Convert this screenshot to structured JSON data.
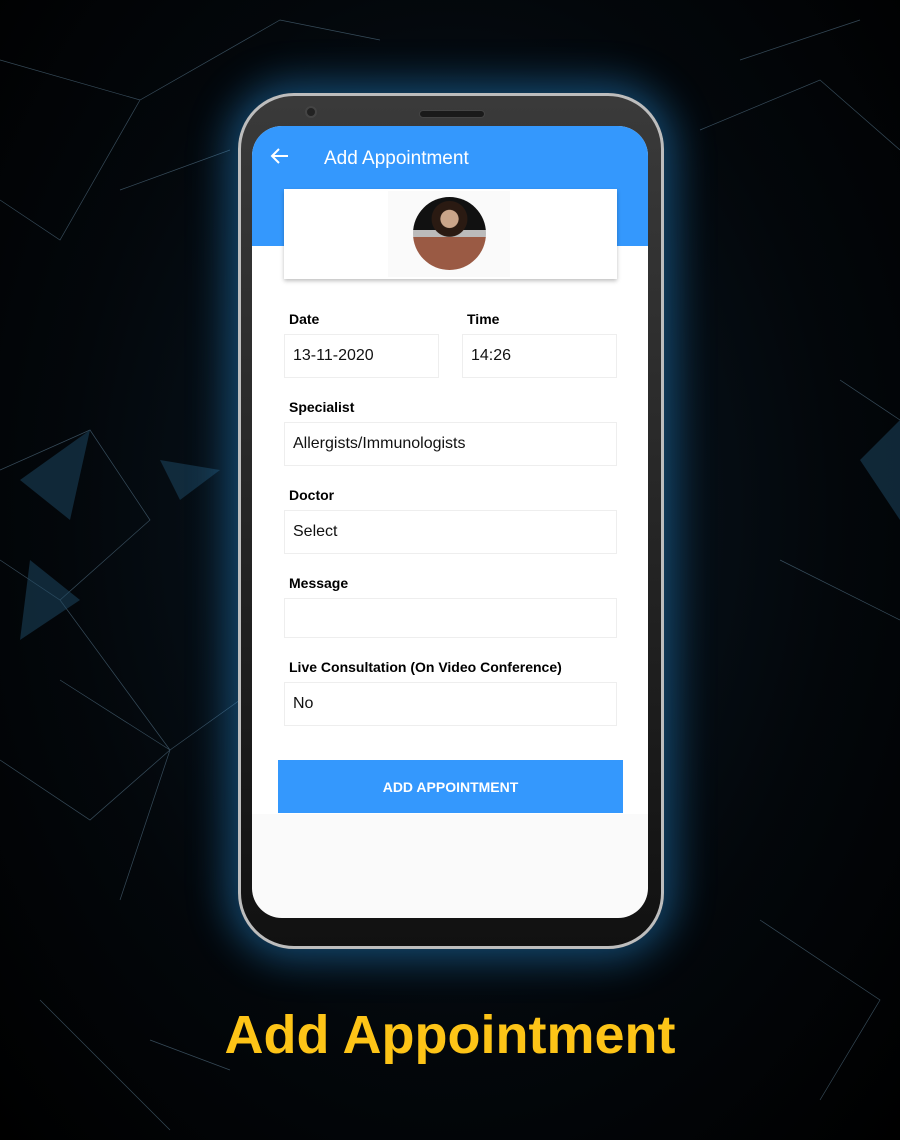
{
  "app_bar": {
    "title": "Add Appointment",
    "back_icon": "arrow-left-icon"
  },
  "form": {
    "date": {
      "label": "Date",
      "value": "13-11-2020"
    },
    "time": {
      "label": "Time",
      "value": "14:26"
    },
    "specialist": {
      "label": "Specialist",
      "value": "Allergists/Immunologists"
    },
    "doctor": {
      "label": "Doctor",
      "value": "Select"
    },
    "message": {
      "label": "Message",
      "value": ""
    },
    "live": {
      "label": "Live Consultation (On Video Conference)",
      "value": "No"
    },
    "submit_label": "ADD APPOINTMENT"
  },
  "caption": "Add Appointment",
  "colors": {
    "primary": "#3498fd",
    "caption": "#fdc417"
  }
}
